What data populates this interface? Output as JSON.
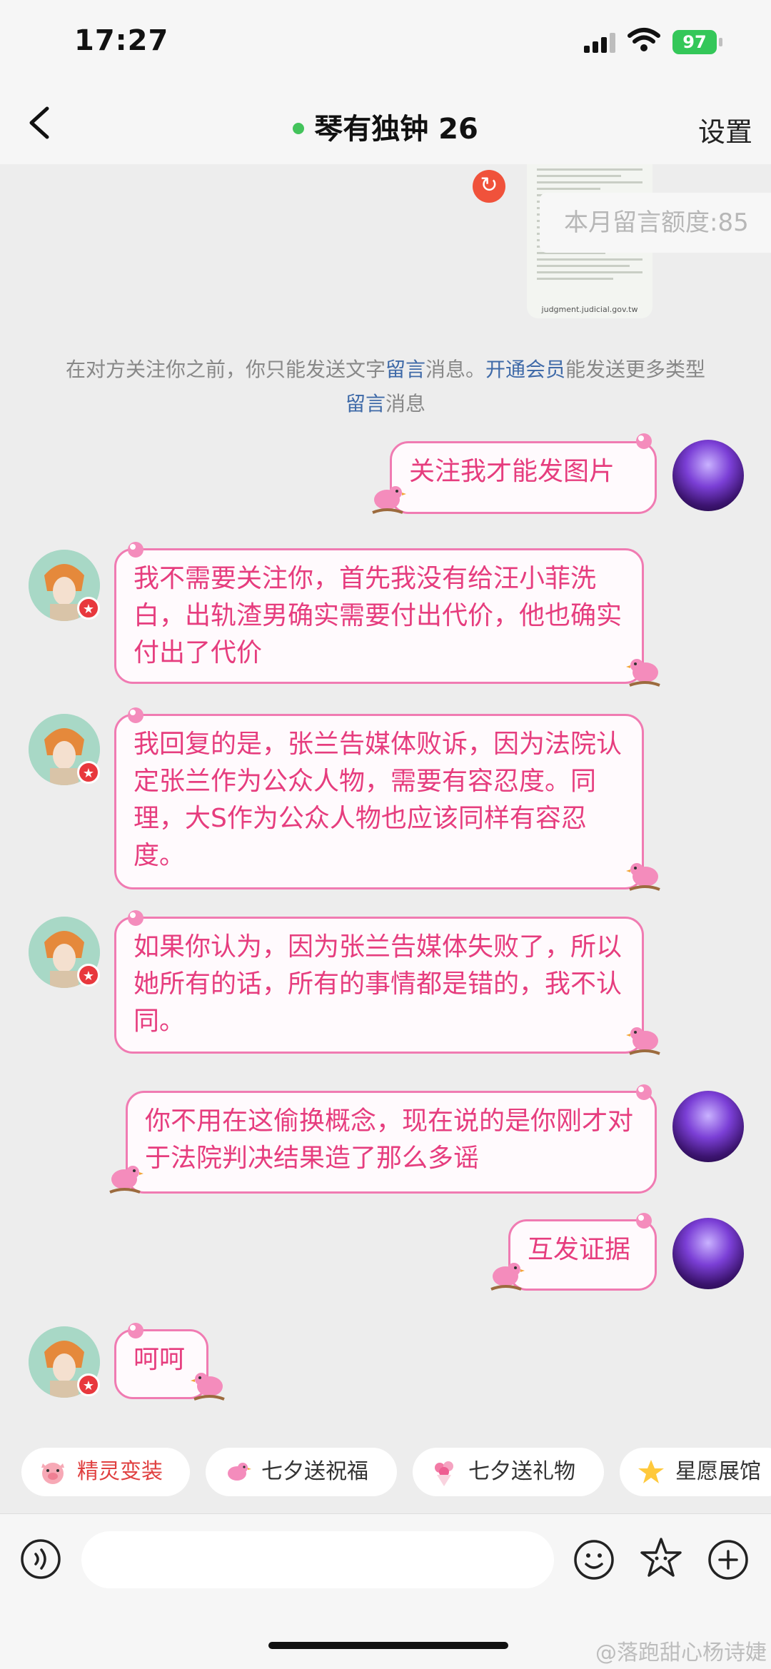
{
  "status_bar": {
    "time": "17:27",
    "battery": "97"
  },
  "header": {
    "title": "琴有独钟 26",
    "settings_label": "设置"
  },
  "sent_image": {
    "url_text": "judgment.judicial.gov.tw",
    "quota_text": "本月留言额度:85"
  },
  "notice": {
    "part1": "在对方关注你之前，你只能发送文字",
    "link1": "留言",
    "part2": "消息。",
    "link2": "开通会员",
    "part3": "能发送更多类型",
    "link3": "留言",
    "part4": "消息"
  },
  "messages": [
    {
      "sender": "me",
      "text": "关注我才能发图片"
    },
    {
      "sender": "other",
      "text": "我不需要关注你，首先我没有给汪小菲洗白，出轨渣男确实需要付出代价，他也确实付出了代价"
    },
    {
      "sender": "other",
      "text": "我回复的是，张兰告媒体败诉，因为法院认定张兰作为公众人物，需要有容忍度。同理，大S作为公众人物也应该同样有容忍度。"
    },
    {
      "sender": "other",
      "text": "如果你认为，因为张兰告媒体失败了，所以她所有的话，所有的事情都是错的，我不认同。"
    },
    {
      "sender": "me",
      "text": "你不用在这偷换概念，现在说的是你刚才对于法院判决结果造了那么多谣"
    },
    {
      "sender": "me",
      "text": "互发证据"
    },
    {
      "sender": "other",
      "text": "呵呵"
    }
  ],
  "quick_actions": [
    {
      "label": "精灵变装",
      "icon": "pig-icon"
    },
    {
      "label": "七夕送祝福",
      "icon": "bird-icon"
    },
    {
      "label": "七夕送礼物",
      "icon": "bouquet-icon"
    },
    {
      "label": "星愿展馆",
      "icon": "star-icon"
    }
  ],
  "composer": {
    "placeholder": ""
  },
  "watermark": "@落跑甜心杨诗婕",
  "colors": {
    "bubble_text": "#e63d7e",
    "bubble_border": "#f07bb2",
    "link": "#3f6aa8",
    "online": "#43c35b"
  }
}
